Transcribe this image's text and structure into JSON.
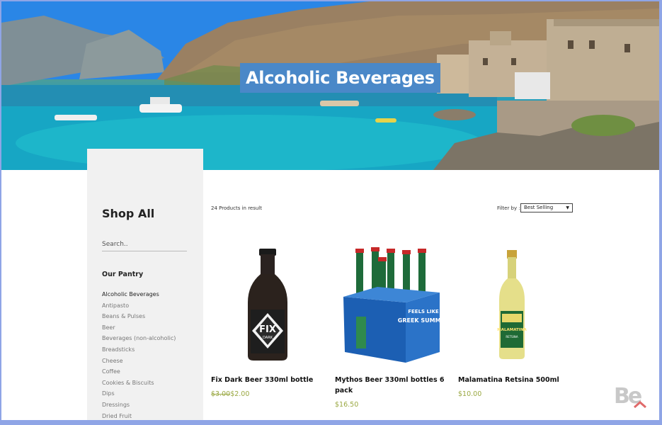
{
  "hero": {
    "title": "Alcoholic Beverages"
  },
  "sidebar": {
    "heading": "Shop All",
    "search_placeholder": "Search..",
    "section_title": "Our Pantry",
    "categories": [
      "Alcoholic Beverages",
      "Antipasto",
      "Beans & Pulses",
      "Beer",
      "Beverages (non-alcoholic)",
      "Breadsticks",
      "Cheese",
      "Coffee",
      "Cookies & Biscuits",
      "Dips",
      "Dressings",
      "Dried Fruit"
    ],
    "active_category": "Alcoholic Beverages"
  },
  "toolbar": {
    "result_count": "24 Products in result",
    "filter_label": "Filter by :",
    "filter_value": "Best Selling"
  },
  "products": [
    {
      "name": "Fix Dark Beer 330ml bottle",
      "old_price": "$3.00",
      "price": "$2.00",
      "image_label": "FIX",
      "image_sublabel": "DARK"
    },
    {
      "name": "Mythos Beer 330ml bottles 6 pack",
      "price": "$16.50",
      "image_label": "FEELS LIKE",
      "image_sublabel": "GREEK SUMMER"
    },
    {
      "name": "Malamatina Retsina 500ml",
      "price": "$10.00",
      "image_label": "MALAMATINA",
      "image_sublabel": "RETSINA"
    }
  ],
  "colors": {
    "title_bg": "#4a88c8",
    "price": "#9aa842",
    "sidebar_bg": "#f1f1f1",
    "frame": "#8fa5e6"
  },
  "watermark": "Be"
}
